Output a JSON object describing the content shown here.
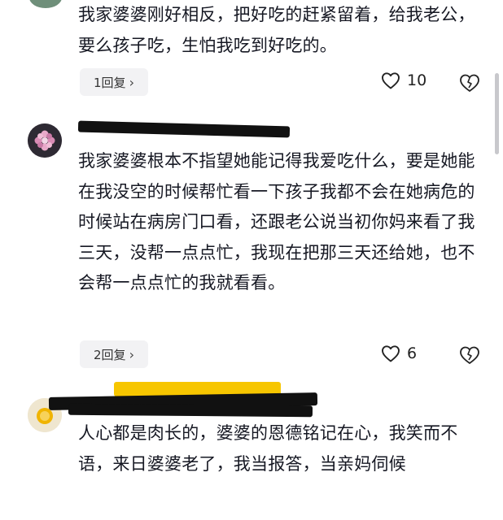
{
  "comments": [
    {
      "text": "我家婆婆刚好相反，把好吃的赶紧留着，给我老公，要么孩子吃，生怕我吃到好吃的。",
      "reply_label": "1回复",
      "likes": "10"
    },
    {
      "text": "我家婆婆根本不指望她能记得我爱吃什么，要是她能在我没空的时候帮忙看一下孩子我都不会在她病危的时候站在病房门口看，还跟老公说当初你妈来看了我三天，没帮一点点忙，我现在把那三天还给她，也不会帮一点点忙的我就看看。",
      "reply_label": "2回复",
      "likes": "6"
    },
    {
      "text": "人心都是肉长的，婆婆的恩德铭记在心，我笑而不语，来日婆婆老了，我当报答，当亲妈伺候"
    }
  ],
  "colors": {
    "highlight": "#f7c600",
    "redaction": "#111111",
    "text": "#161823"
  },
  "icons": {
    "reply_chevron": "›",
    "like": "heart-outline-icon",
    "dislike": "broken-heart-icon"
  }
}
